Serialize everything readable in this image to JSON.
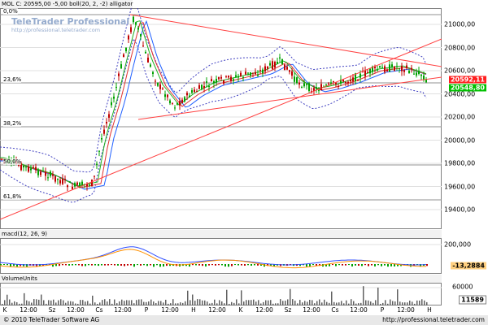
{
  "main": {
    "title": "MOL C: 20595,00 -5,00 boll(20, 2, -2) alligator",
    "watermark_title": "TeleTrader Professional",
    "watermark_url": "http://professional.teletrader.com",
    "y_ticks": [
      "21000,00",
      "20800,00",
      "20600,00",
      "20400,00",
      "20200,00",
      "20000,00",
      "19800,00",
      "19600,00",
      "19400,00"
    ],
    "last_price_high": "20592,11",
    "last_price_low": "20548,80",
    "fib_levels": [
      "0,0%",
      "23,6%",
      "38,2%",
      "50,0%",
      "61,8%"
    ]
  },
  "macd": {
    "title": "macd(12, 26, 9)",
    "y_tick": "200,000",
    "last_value": "-13,2884"
  },
  "volume": {
    "title": "VolumeUnits",
    "y_tick": "60000",
    "last_value": "11589"
  },
  "x_axis": {
    "labels": [
      "K",
      "12:00",
      "Sz",
      "12:00",
      "Cs",
      "12:00",
      "P",
      "12:00",
      "H",
      "12:00",
      "K",
      "12:00",
      "Sz",
      "12:00",
      "Cs",
      "12:00",
      "P",
      "12:00",
      "H"
    ]
  },
  "footer": {
    "copyright": "© 2010 TeleTrader Software AG",
    "url": "http://professional.teletrader.com"
  },
  "colors": {
    "up": "#00a000",
    "down": "#c00000",
    "trendline": "#ff4040",
    "bollinger": "#4040c0",
    "alligator_jaw": "#2060ff",
    "alligator_teeth": "#e03030",
    "alligator_lips": "#20b020",
    "macd_line": "#3050ff",
    "signal_line": "#ff9000",
    "price_box_red": "#ff0000",
    "price_box_green": "#00c000"
  }
}
